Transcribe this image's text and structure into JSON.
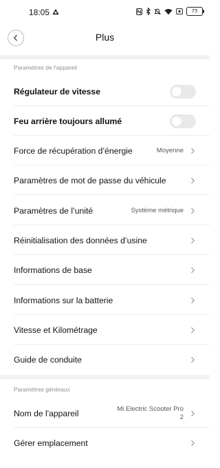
{
  "status_bar": {
    "time": "18:05",
    "battery": "75"
  },
  "header": {
    "title": "Plus"
  },
  "sections": [
    {
      "title": "Paramètres de l'appareil",
      "rows": [
        {
          "label": "Régulateur de vitesse",
          "type": "toggle",
          "value": false
        },
        {
          "label": "Feu arrière toujours allumé",
          "type": "toggle",
          "value": false
        },
        {
          "label": "Force de récupération d’énergie",
          "type": "link",
          "value": "Moyenne"
        },
        {
          "label": "Paramètres de mot de passe du véhicule",
          "type": "link"
        },
        {
          "label": "Paramètres de l’unité",
          "type": "link",
          "value": "Système métrique"
        },
        {
          "label": "Réinitialisation des données d’usine",
          "type": "link"
        },
        {
          "label": "Informations de base",
          "type": "link"
        },
        {
          "label": "Informations sur la batterie",
          "type": "link"
        },
        {
          "label": "Vitesse et Kilométrage",
          "type": "link"
        },
        {
          "label": "Guide de conduite",
          "type": "link"
        }
      ]
    },
    {
      "title": "Paramètres généraux",
      "rows": [
        {
          "label": "Nom de l'appareil",
          "type": "link",
          "value_line1": "Mi Electric Scooter Pro",
          "value_line2": "2"
        },
        {
          "label": "Gérer emplacement",
          "type": "link"
        }
      ]
    }
  ],
  "colors": {
    "background": "#ffffff",
    "section_band": "#f1f1f1",
    "toggle_off": "#e9e9e9",
    "secondary_text": "#8f8f8f"
  },
  "icons": {
    "back": "chevron-left-icon",
    "row_arrow": "chevron-right-icon"
  }
}
